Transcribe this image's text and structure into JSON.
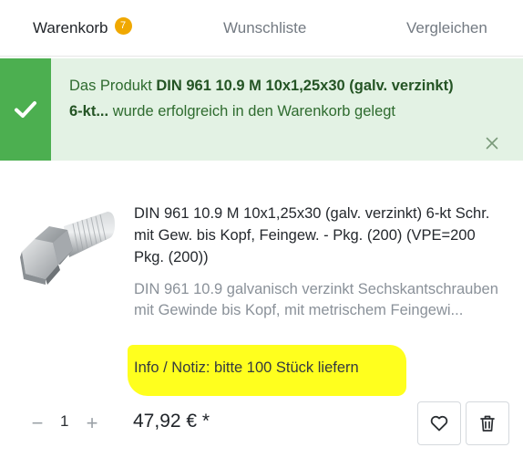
{
  "tabs": {
    "cart": {
      "label": "Warenkorb",
      "count": "7"
    },
    "wishlist": {
      "label": "Wunschliste"
    },
    "compare": {
      "label": "Vergleichen"
    }
  },
  "alert": {
    "prefix": "Das Produkt ",
    "product_name": "DIN 961 10.9 M 10x1,25x30 (galv. verzinkt) 6-kt...",
    "suffix": " wurde erfolgreich in den Warenkorb gelegt",
    "icon": "checkmark-icon",
    "close_icon": "close-icon"
  },
  "product": {
    "title": "DIN 961 10.9 M 10x1,25x30 (galv. verzinkt) 6-kt Schr. mit Gew. bis Kopf, Feingew. - Pkg. (200) (VPE=200 Pkg. (200))",
    "description": "DIN 961 10.9 galvanisch verzinkt Sechskantschrauben mit Gewinde bis Kopf, mit metrischem Feingewi...",
    "note": "Info / Notiz: bitte 100 Stück liefern",
    "image": "hex-bolt-image",
    "quantity": "1",
    "price": "47,92 € *"
  },
  "controls": {
    "minus": "−",
    "plus": "+",
    "wishlist_icon": "heart-icon",
    "delete_icon": "trash-icon"
  },
  "colors": {
    "success_strip": "#4caf50",
    "success_bg": "#e3f2e4",
    "badge": "#f0a800",
    "highlight": "#ffff1e"
  }
}
